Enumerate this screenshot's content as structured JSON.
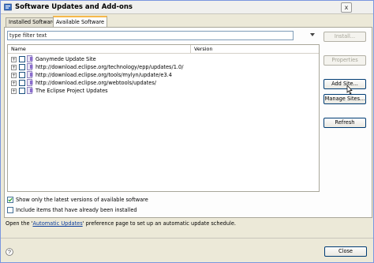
{
  "window": {
    "title": "Software Updates and Add-ons",
    "close_glyph": "x"
  },
  "tabs": [
    {
      "label": "Installed Software",
      "active": false
    },
    {
      "label": "Available Software",
      "active": true
    }
  ],
  "filter": {
    "value": "type filter text"
  },
  "tree": {
    "columns": [
      "Name",
      "Version"
    ],
    "rows": [
      {
        "label": "Ganymede Update Site",
        "expander": "+",
        "checked": false,
        "icon": "update-site-icon"
      },
      {
        "label": "http://download.eclipse.org/technology/epp/updates/1.0/",
        "expander": "+",
        "checked": false,
        "icon": "update-site-icon"
      },
      {
        "label": "http://download.eclipse.org/tools/mylyn/update/e3.4",
        "expander": "+",
        "checked": false,
        "icon": "update-site-icon"
      },
      {
        "label": "http://download.eclipse.org/webtools/updates/",
        "expander": "+",
        "checked": false,
        "icon": "update-site-icon"
      },
      {
        "label": "The Eclipse Project Updates",
        "expander": "+",
        "checked": false,
        "icon": "update-site-icon"
      }
    ]
  },
  "buttons": {
    "install": "Install...",
    "properties": "Properties",
    "add_site": "Add Site...",
    "manage_sites": "Manage Sites...",
    "refresh": "Refresh",
    "close": "Close"
  },
  "options": {
    "latest_only": {
      "label": "Show only the latest versions of available software",
      "checked": true
    },
    "include_installed": {
      "label": "Include items that have already been installed",
      "checked": false
    }
  },
  "footer": {
    "prefix": "Open the '",
    "link": "Automatic Updates",
    "suffix": "' preference page to set up an automatic update schedule."
  },
  "colors": {
    "accent_tab": "#f6b94c",
    "link": "#0a3c9c",
    "button_border": "#003c74"
  }
}
